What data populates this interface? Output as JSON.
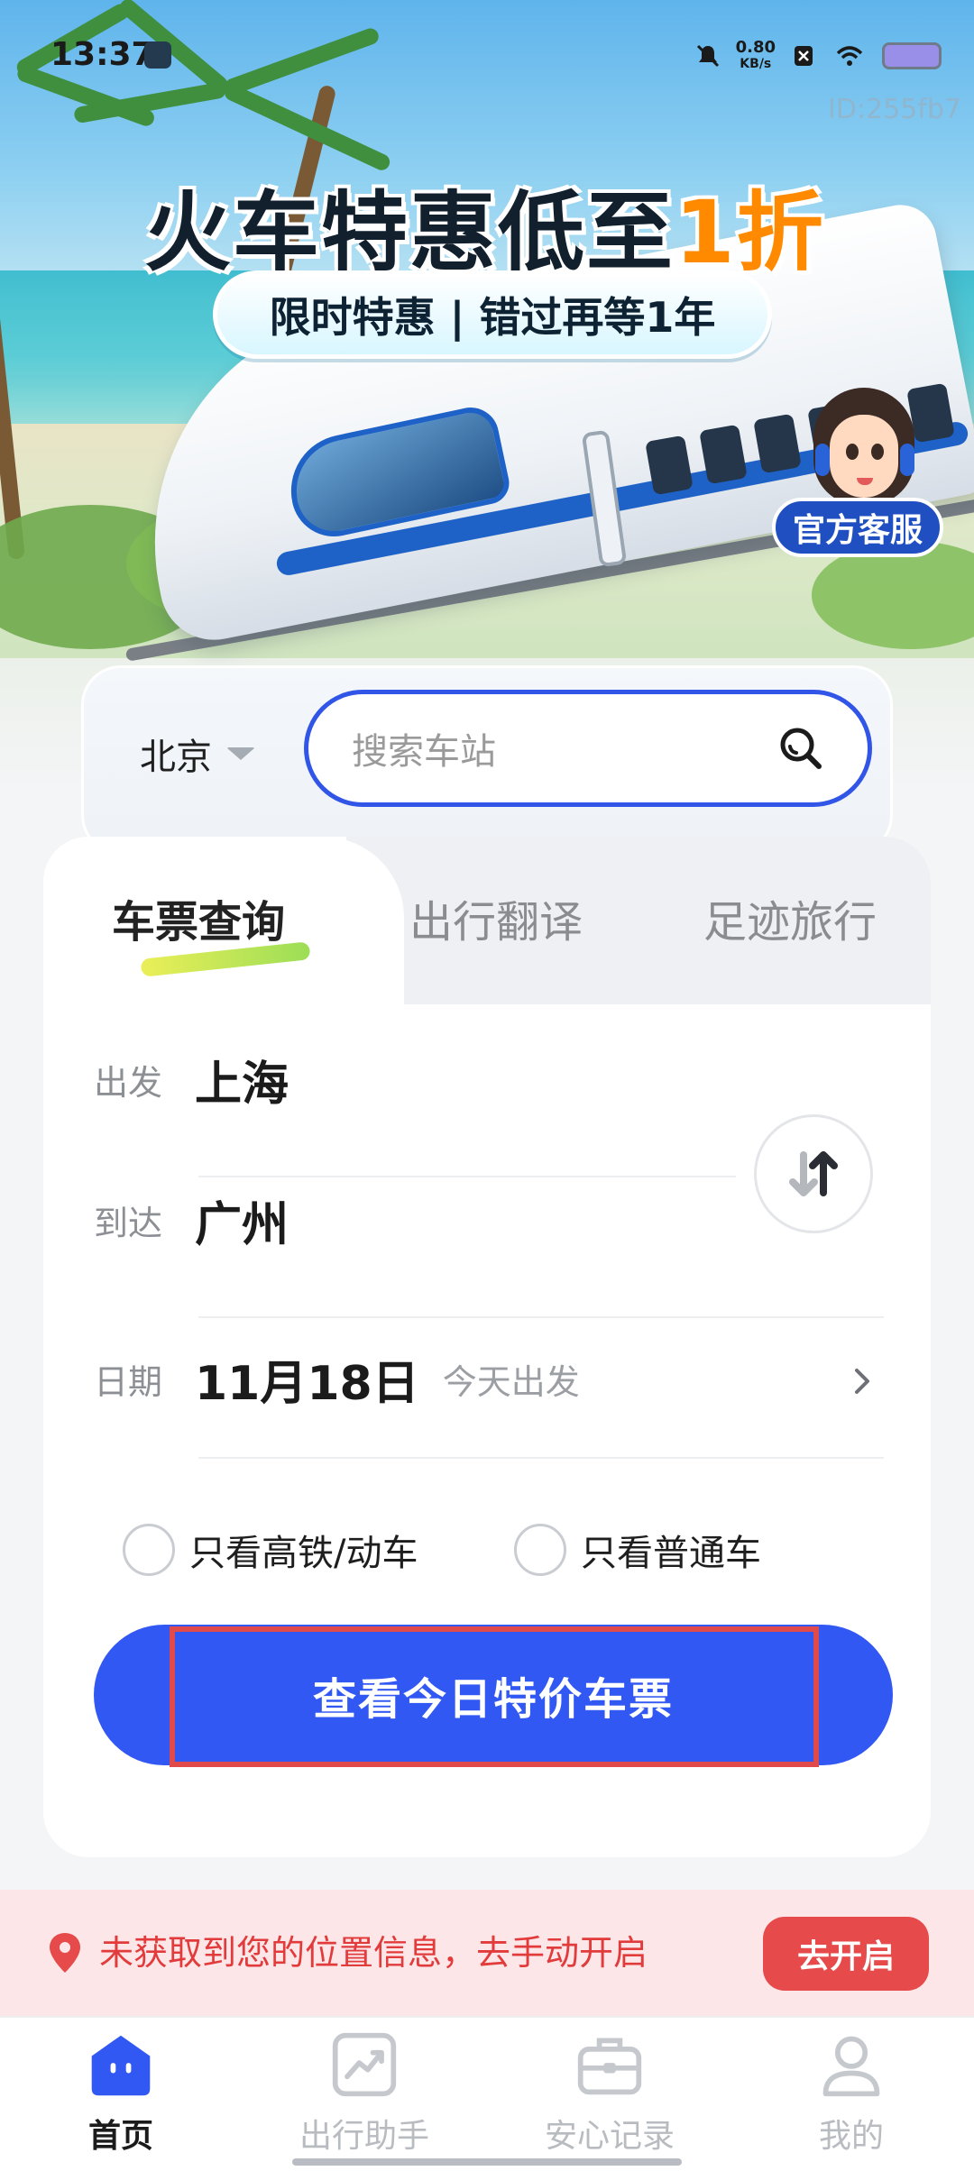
{
  "status": {
    "time": "13:37",
    "net_speed_value": "0.80",
    "net_speed_unit": "KB/s",
    "watermark": "ID:255fb7"
  },
  "banner": {
    "title_main": "火车特惠低至",
    "title_accent": "1折",
    "subtitle": "限时特惠 | 错过再等1年",
    "service_label": "官方客服"
  },
  "station_search": {
    "city": "北京",
    "placeholder": "搜索车站"
  },
  "tabs": [
    "车票查询",
    "出行翻译",
    "足迹旅行"
  ],
  "form": {
    "depart_label": "出发",
    "depart_value": "上海",
    "arrive_label": "到达",
    "arrive_value": "广州",
    "date_label": "日期",
    "date_value": "11月18日",
    "date_note": "今天出发",
    "option_high_speed": "只看高铁/动车",
    "option_regular": "只看普通车",
    "submit_label": "查看今日特价车票"
  },
  "location_notice": {
    "text": "未获取到您的位置信息，去手动开启",
    "button": "去开启"
  },
  "bottom_nav": {
    "items": [
      {
        "label": "首页",
        "icon": "home-icon",
        "active": true
      },
      {
        "label": "出行助手",
        "icon": "trend-icon",
        "active": false
      },
      {
        "label": "安心记录",
        "icon": "briefcase-icon",
        "active": false
      },
      {
        "label": "我的",
        "icon": "user-icon",
        "active": false
      }
    ]
  },
  "colors": {
    "primary": "#3158f3",
    "accent_orange": "#ff8a00",
    "alert_red": "#e64a4a",
    "alert_bg": "#fde6e8"
  }
}
